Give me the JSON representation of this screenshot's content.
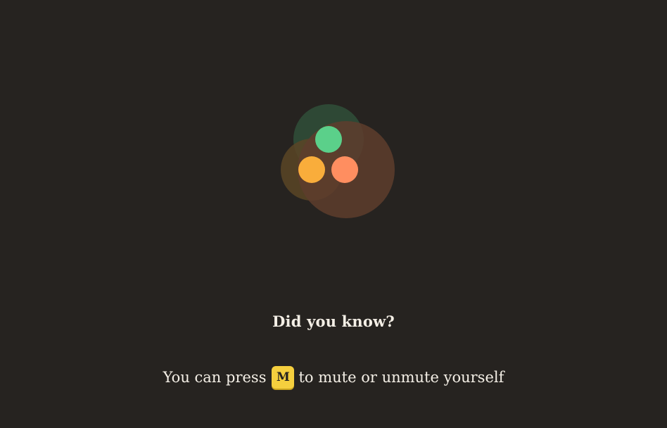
{
  "loader": {
    "icon": "participants-loading-icon",
    "colors": {
      "green": "#5bd08a",
      "orange": "#f9ad3b",
      "coral": "#ff8e60",
      "green_halo": "#2e4b37",
      "orange_halo": "#5a4526",
      "coral_halo": "#5e3d2d",
      "background": "#262320"
    }
  },
  "tip": {
    "heading": "Did you know?",
    "text_before": "You can press",
    "key": "M",
    "text_after": "to mute or unmute yourself"
  }
}
